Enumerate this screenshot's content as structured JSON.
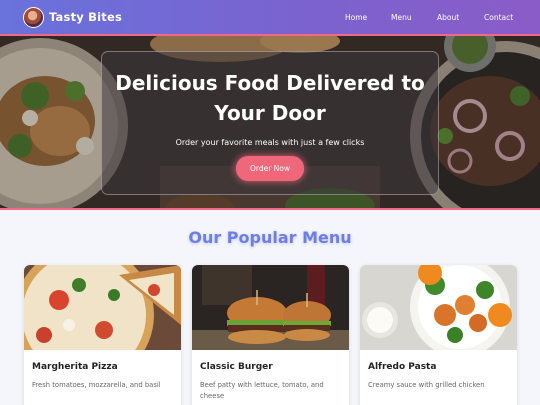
{
  "brand": {
    "name": "Tasty Bites",
    "logo_icon": "food-logo-icon"
  },
  "nav": {
    "items": [
      {
        "label": "Home"
      },
      {
        "label": "Menu"
      },
      {
        "label": "About"
      },
      {
        "label": "Contact"
      }
    ]
  },
  "hero": {
    "title": "Delicious Food Delivered to Your Door",
    "subtitle": "Order your favorite meals with just a few clicks",
    "cta_label": "Order Now"
  },
  "menu": {
    "heading": "Our Popular Menu",
    "items": [
      {
        "name": "Margherita Pizza",
        "description": "Fresh tomatoes, mozzarella, and basil",
        "price": ""
      },
      {
        "name": "Classic Burger",
        "description": "Beef patty with lettuce, tomato, and cheese",
        "price": ""
      },
      {
        "name": "Alfredo Pasta",
        "description": "Creamy sauce with grilled chicken",
        "price": ""
      }
    ]
  },
  "colors": {
    "nav_gradient_start": "#6a72dc",
    "nav_gradient_end": "#8a5cc8",
    "accent": "#f0677a",
    "heading": "#6f7ee3",
    "background": "#f4f6fb"
  }
}
